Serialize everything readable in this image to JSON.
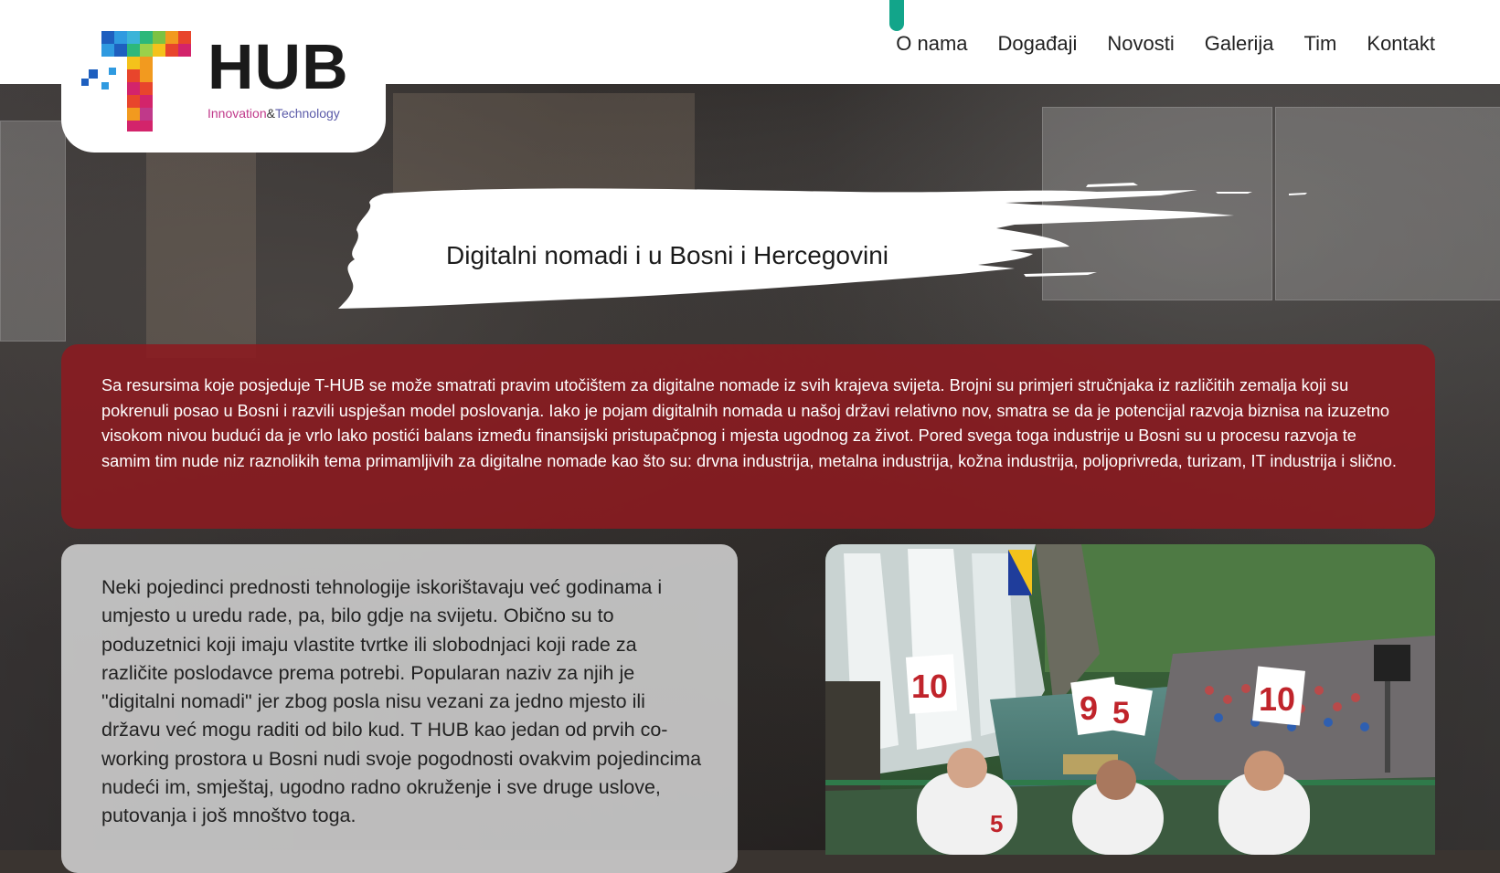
{
  "header": {
    "logo": {
      "brand": "HUB",
      "tagline_part1": "Innovation",
      "tagline_amp": "&",
      "tagline_part2": "Technology"
    },
    "nav": [
      "O nama",
      "Događaji",
      "Novosti",
      "Galerija",
      "Tim",
      "Kontakt"
    ]
  },
  "hero": {
    "title": "Digitalni nomadi i u Bosni i Hercegovini"
  },
  "intro": {
    "text": "Sa resursima koje posjeduje T-HUB se može smatrati pravim utočištem za digitalne nomade iz svih krajeva svijeta. Brojni su primjeri stručnjaka iz različitih zemalja koji su pokrenuli posao u Bosni i razvili uspješan model poslovanja. Iako je pojam digitalnih nomada u našoj državi relativno nov, smatra se da je potencijal razvoja biznisa na izuzetno visokom nivou budući da je vrlo lako postići balans između finansijski pristupačpnog i mjesta ugodnog za život. Pored svega toga industrije u Bosni su u procesu razvoja te samim tim nude niz raznolikih tema primamljivih za digitalne nomade kao što su: drvna industrija, metalna industrija, kožna industrija, poljoprivreda, turizam, IT industrija i slično."
  },
  "body": {
    "text": "Neki pojedinci prednosti tehnologije iskorištavaju već godinama i umjesto u uredu rade, pa, bilo gdje na svijetu. Obično su to poduzetnici koji imaju vlastite tvrtke ili slobodnjaci koji rade za različite poslodavce prema potrebi. Popularan naziv za njih je \"digitalni nomadi\" jer zbog posla nisu vezani za jedno mjesto ili državu već mogu raditi od bilo kud. T HUB kao jedan od prvih co-working prostora u Bosni nudi svoje pogodnosti ovakvim pojedincima nudeći im, smještaj, ugodno radno okruženje i sve druge uslove, putovanja i još mnoštvo toga."
  },
  "photo": {
    "scores": [
      "10",
      "9",
      "5",
      "10",
      "5"
    ]
  },
  "colors": {
    "accent_teal": "#12a58a",
    "intro_bg": "#8c1a20",
    "body_bg": "#d2d2d2"
  }
}
